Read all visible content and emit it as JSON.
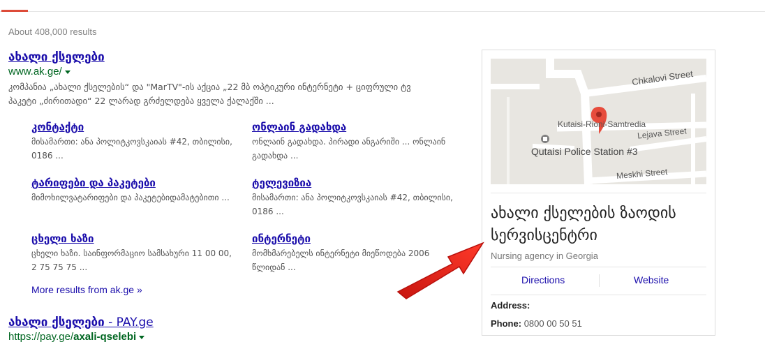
{
  "header": {
    "stats": "About 408,000 results"
  },
  "colors": {
    "accent_tab": "#dd4b39",
    "link": "#1a0dab",
    "url": "#006621",
    "arrow": "#e0201c"
  },
  "results": [
    {
      "title": "ახალი ქსელები",
      "url": "www.ak.ge/",
      "snippet": "კომპანია „ახალი ქსელების“ და \"MarTV\"-ის აქცია „22 მბ ოპტიკური ინტერნეტი + ციფრული ტვ პაკეტი „ძირითადი“ 22 ლარად გრძელდება ყველა ქალაქში ...",
      "sitelinks": [
        {
          "title": "კონტაქტი",
          "desc": "მისამართი: ანა პოლიტკოვსკაიას #42, თბილისი, 0186 ..."
        },
        {
          "title": "ონლაინ გადახდა",
          "desc": "ონლაინ გადახდა. პირადი ანგარიში ... ონლაინ გადახდა ..."
        },
        {
          "title": "ტარიფები და პაკეტები",
          "desc": "მიმოხილვატარიფები და პაკეტებიდამატებითი ..."
        },
        {
          "title": "ტელევიზია",
          "desc": "მისამართი: ანა პოლიტკოვსკაიას #42, თბილისი, 0186 ..."
        },
        {
          "title": "ცხელი ხაზი",
          "desc": "ცხელი ხაზი. საინფორმაციო სამსახური 11 00 00, 2 75 75 75 ..."
        },
        {
          "title": "ინტერნეტი",
          "desc": "მომხმარებელს ინტერნეტი მიეწოდება 2006 წლიდან ..."
        }
      ],
      "more": "More results from ak.ge »"
    },
    {
      "title_bold": "ახალი ქსელები",
      "title_rest": " - PAY.ge",
      "url": "https://pay.ge/",
      "url_bold": "axali-qselebi"
    }
  ],
  "panel": {
    "map_labels": {
      "street1": "Chkalovi Street",
      "street2": "Kutaisi-Rioni-Samtredia",
      "street3": "Lejava Street",
      "street4": "Meskhi Street",
      "poi": "Qutaisi Police Station #3"
    },
    "title": "ახალი ქსელების ზაოდის სერვისცენტრი",
    "subtitle": "Nursing agency in Georgia",
    "directions": "Directions",
    "website": "Website",
    "address_label": "Address:",
    "address_value": "",
    "phone_label": "Phone:",
    "phone_value": "0800 00 50 51"
  },
  "icons": {
    "map_pin": "map-pin-icon",
    "poi": "poi-marker-icon",
    "arrow": "red-arrow-icon"
  }
}
